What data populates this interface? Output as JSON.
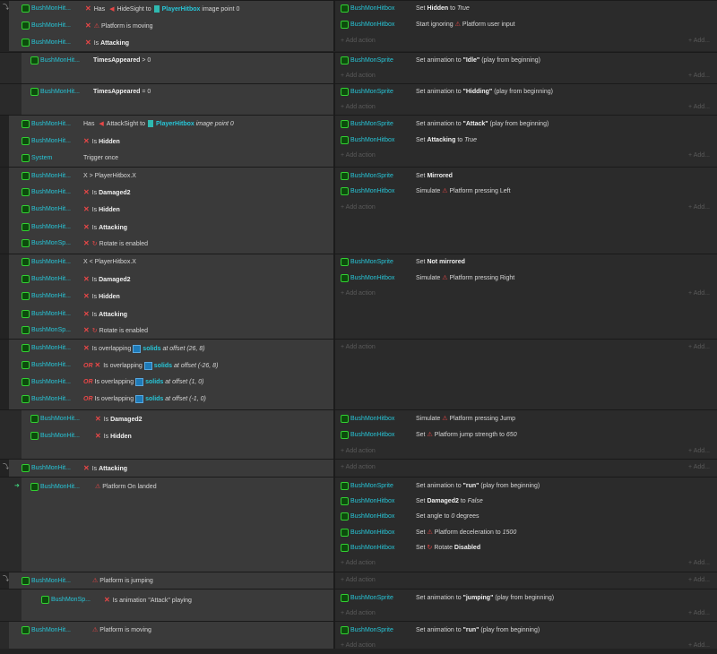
{
  "obj_hitbox_short": "BushMonHit...",
  "obj_hitbox": "BushMonHitbox",
  "obj_sprite": "BushMonSprite",
  "obj_sprite_short": "BushMonSp...",
  "obj_system": "System",
  "add_action": "Add action",
  "add": "Add...",
  "or": "OR",
  "e1": {
    "c1_pre": "Has",
    "c1_mid": "HideSight to",
    "c1_obj": "PlayerHitbox",
    "c1_post": "image point 0",
    "c2": "Platform is moving",
    "c3_pre": "Is",
    "c3_b": "Attacking",
    "a1_pre": "Set",
    "a1_b": "Hidden",
    "a1_mid": "to",
    "a1_i": "True",
    "a2_pre": "Start ignoring",
    "a2_post": "Platform user input"
  },
  "e2": {
    "c1_b": "TimesAppeared",
    "c1_post": "> 0",
    "a1_pre": "Set animation to",
    "a1_b": "\"Idle\"",
    "a1_post": "(play from beginning)"
  },
  "e3": {
    "c1_b": "TimesAppeared",
    "c1_post": "= 0",
    "a1_pre": "Set animation to",
    "a1_b": "\"Hidding\"",
    "a1_post": "(play from beginning)"
  },
  "e4": {
    "c1_pre": "Has",
    "c1_mid": "AttackSight to",
    "c1_obj": "PlayerHitbox",
    "c1_post": "image point 0",
    "c2_pre": "Is",
    "c2_b": "Hidden",
    "c3": "Trigger once",
    "a1_pre": "Set animation to",
    "a1_b": "\"Attack\"",
    "a1_post": "(play from beginning)",
    "a2_pre": "Set",
    "a2_b": "Attacking",
    "a2_mid": "to",
    "a2_i": "True"
  },
  "e5": {
    "c1": "X > PlayerHitbox.X",
    "c2_pre": "Is",
    "c2_b": "Damaged2",
    "c3_pre": "Is",
    "c3_b": "Hidden",
    "c4_pre": "Is",
    "c4_b": "Attacking",
    "c5": "Rotate is enabled",
    "a1_pre": "Set",
    "a1_b": "Mirrored",
    "a2_pre": "Simulate",
    "a2_post": "Platform pressing Left"
  },
  "e6": {
    "c1": "X < PlayerHitbox.X",
    "c2_pre": "Is",
    "c2_b": "Damaged2",
    "c3_pre": "Is",
    "c3_b": "Hidden",
    "c4_pre": "Is",
    "c4_b": "Attacking",
    "c5": "Rotate is enabled",
    "a1_pre": "Set",
    "a1_b": "Not mirrored",
    "a2_pre": "Simulate",
    "a2_post": "Platform pressing Right"
  },
  "e7": {
    "c1_pre": "Is overlapping",
    "c1_obj": "solids",
    "c1_post": "at offset (26, 8)",
    "c2_pre": "Is overlapping",
    "c2_obj": "solids",
    "c2_post": "at offset (-26, 8)",
    "c3_pre": "Is overlapping",
    "c3_obj": "solids",
    "c3_post": "at offset (1, 0)",
    "c4_pre": "Is overlapping",
    "c4_obj": "solids",
    "c4_post": "at offset (-1, 0)"
  },
  "e8": {
    "c1_pre": "Is",
    "c1_b": "Damaged2",
    "c2_pre": "Is",
    "c2_b": "Hidden",
    "a1_pre": "Simulate",
    "a1_post": "Platform pressing Jump",
    "a2_pre": "Set",
    "a2_post": "Platform jump strength to",
    "a2_i": "650"
  },
  "e9": {
    "c1_pre": "Is",
    "c1_b": "Attacking"
  },
  "e10": {
    "c1": "Platform On landed",
    "a1_pre": "Set animation to",
    "a1_b": "\"run\"",
    "a1_post": "(play from beginning)",
    "a2_pre": "Set",
    "a2_b": "Damaged2",
    "a2_mid": "to",
    "a2_i": "False",
    "a3_pre": "Set angle to",
    "a3_i": "0",
    "a3_post": "degrees",
    "a4_pre": "Set",
    "a4_post": "Platform deceleration to",
    "a4_i": "1500",
    "a5_pre": "Set",
    "a5_mid": "Rotate",
    "a5_b": "Disabled"
  },
  "e11": {
    "c1": "Platform is jumping"
  },
  "e12": {
    "c1_pre": "Is animation \"Attack\" playing",
    "a1_pre": "Set animation to",
    "a1_b": "\"jumping\"",
    "a1_post": "(play from beginning)"
  },
  "e13": {
    "c1": "Platform is moving",
    "a1_pre": "Set animation to",
    "a1_b": "\"run\"",
    "a1_post": "(play from beginning)"
  }
}
